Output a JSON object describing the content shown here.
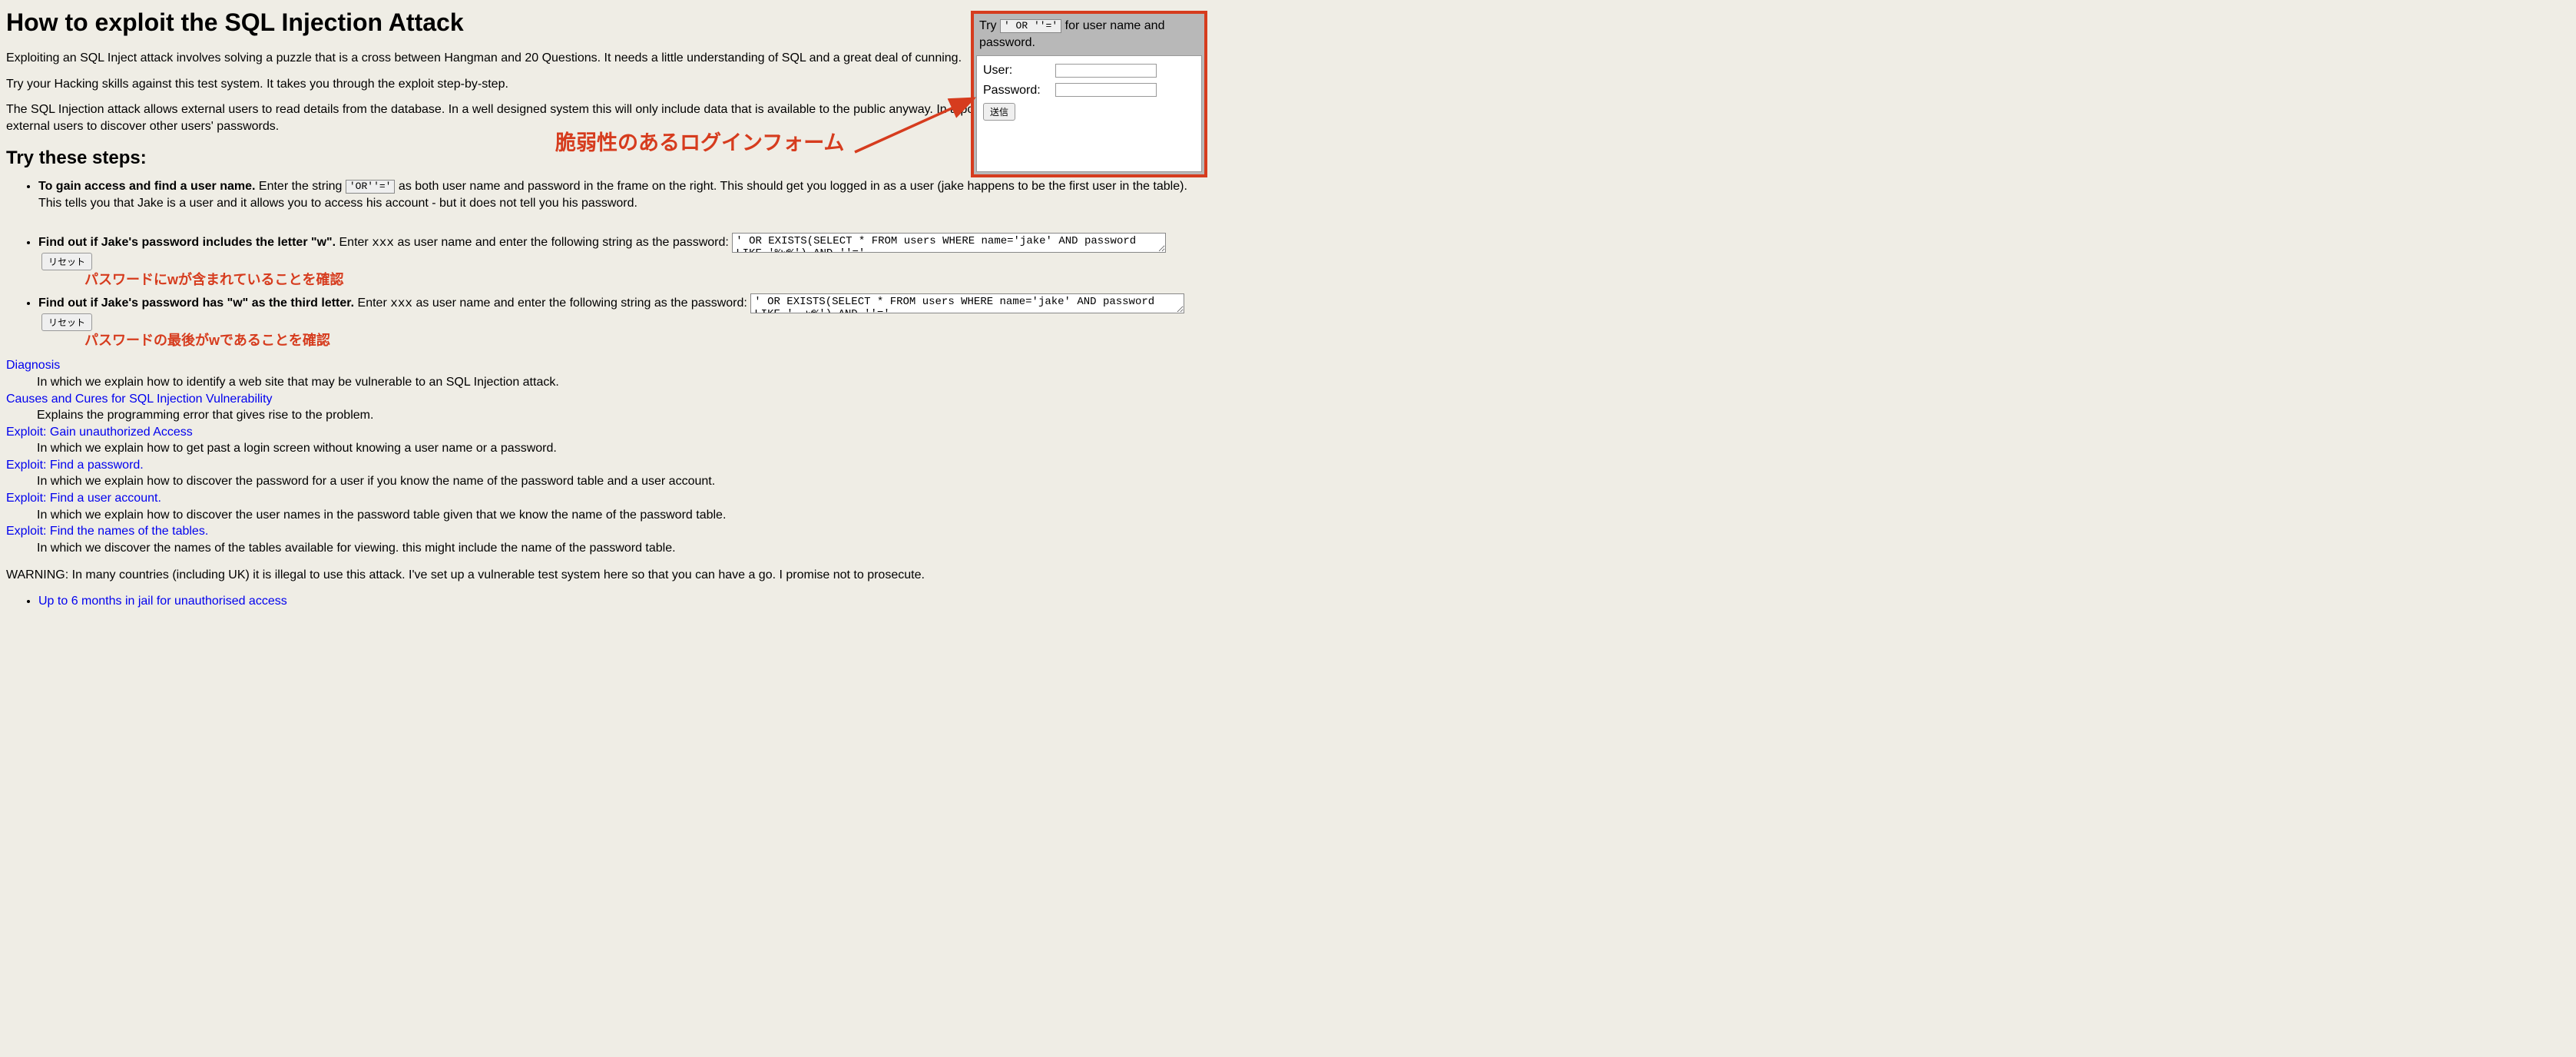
{
  "title": "How to exploit the SQL Injection Attack",
  "intro": {
    "p1": "Exploiting an SQL Inject attack involves solving a puzzle that is a cross between Hangman and 20 Questions. It needs a little understanding of SQL and a great deal of cunning.",
    "p2": "Try your Hacking skills against this test system. It takes you through the exploit step-by-step.",
    "p3": "The SQL Injection attack allows external users to read details from the database. In a well designed system this will only include data that is available to the public anyway. In a poorly designed system this may allow external users to discover other users' passwords."
  },
  "steps_heading": "Try these steps:",
  "steps": {
    "s1": {
      "lead": "To gain access and find a user name.",
      "before_code": " Enter the string ",
      "code": "'OR''='",
      "after_code": " as both user name and password in the frame on the right. This should get you logged in as a user (jake happens to be the first user in the table). This tells you that Jake is a user and it allows you to access his account - but it does not tell you his password."
    },
    "s2": {
      "lead": "Find out if Jake's password includes the letter \"w\".",
      "mid1": " Enter ",
      "xxx": "xxx",
      "mid2": " as user name and enter the following string as the password:",
      "ta": "' OR EXISTS(SELECT * FROM users WHERE name='jake' AND password LIKE '%w%') AND ''='",
      "reset": "リセット",
      "annot": "パスワードにwが含まれていることを確認"
    },
    "s3": {
      "lead": "Find out if Jake's password has \"w\" as the third letter.",
      "mid1": " Enter ",
      "xxx": "xxx",
      "mid2": " as user name and enter the following string as the password:",
      "ta": "' OR EXISTS(SELECT * FROM users WHERE name='jake' AND password LIKE '__w%') AND ''='",
      "reset": "リセット",
      "annot": "パスワードの最後がwであることを確認"
    }
  },
  "links": {
    "l1": {
      "t": "Diagnosis",
      "d": "In which we explain how to identify a web site that may be vulnerable to an SQL Injection attack."
    },
    "l2": {
      "t": "Causes and Cures for SQL Injection Vulnerability",
      "d": "Explains the programming error that gives rise to the problem."
    },
    "l3": {
      "t": "Exploit: Gain unauthorized Access",
      "d": "In which we explain how to get past a login screen without knowing a user name or a password."
    },
    "l4": {
      "t": "Exploit: Find a password.",
      "d": "In which we explain how to discover the password for a user if you know the name of the password table and a user account."
    },
    "l5": {
      "t": "Exploit: Find a user account.",
      "d": "In which we explain how to discover the user names in the password table given that we know the name of the password table."
    },
    "l6": {
      "t": "Exploit: Find the names of the tables.",
      "d": "In which we discover the names of the tables available for viewing. this might include the name of the password table."
    }
  },
  "warning": "WARNING: In many countries (including UK) it is illegal to use this attack. I've set up a vulnerable test system here so that you can have a go. I promise not to prosecute.",
  "warning_link": "Up to 6 months in jail for unauthorised access",
  "login": {
    "hint_before": "Try ",
    "hint_code": "' OR ''='",
    "hint_after": " for user name and password.",
    "user_label": "User:",
    "pass_label": "Password:",
    "submit": "送信"
  },
  "form_annotation": "脆弱性のあるログインフォーム"
}
